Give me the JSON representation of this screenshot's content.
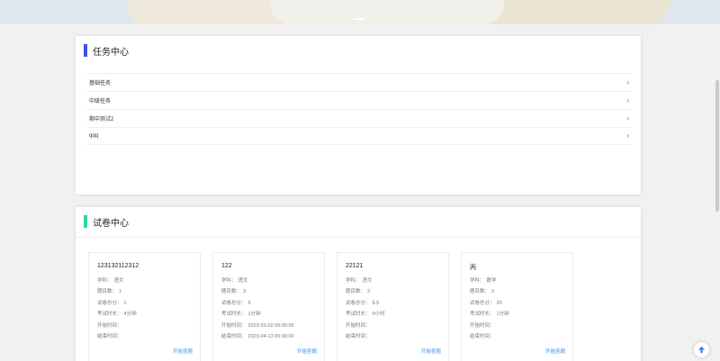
{
  "task_center": {
    "title": "任务中心",
    "accent": "#3b4fe4",
    "items": [
      {
        "label": "基础任务"
      },
      {
        "label": "中级任务"
      },
      {
        "label": "期中测试2"
      },
      {
        "label": "qqq"
      }
    ]
  },
  "paper_center": {
    "title": "试卷中心",
    "accent": "#2fd3a8",
    "field_labels": {
      "subject": "学科：",
      "question_count": "题目数：",
      "total_score": "试卷总分：",
      "duration": "考试时长：",
      "start_time": "开始时间：",
      "end_time": "结束时间："
    },
    "action_label": "开始答题",
    "action_color": "#3a8ee6",
    "cards": [
      {
        "name": "123132112312",
        "subject": "语文",
        "question_count": "1",
        "total_score": "1",
        "duration": "4分钟",
        "start_time": "",
        "end_time": ""
      },
      {
        "name": "122",
        "subject": "语文",
        "question_count": "3",
        "total_score": "5",
        "duration": "1分钟",
        "start_time": "2023-03-02 00:00:00",
        "end_time": "2023-04-13 00:00:00"
      },
      {
        "name": "22121",
        "subject": "语文",
        "question_count": "3",
        "total_score": "6.5",
        "duration": "5小时",
        "start_time": "",
        "end_time": ""
      },
      {
        "name": "丙",
        "subject": "数学",
        "question_count": "2",
        "total_score": "20",
        "duration": "1分钟",
        "start_time": "",
        "end_time": ""
      }
    ]
  },
  "back_to_top": {
    "icon": "arrow-up-icon",
    "color": "#2f80ed"
  }
}
